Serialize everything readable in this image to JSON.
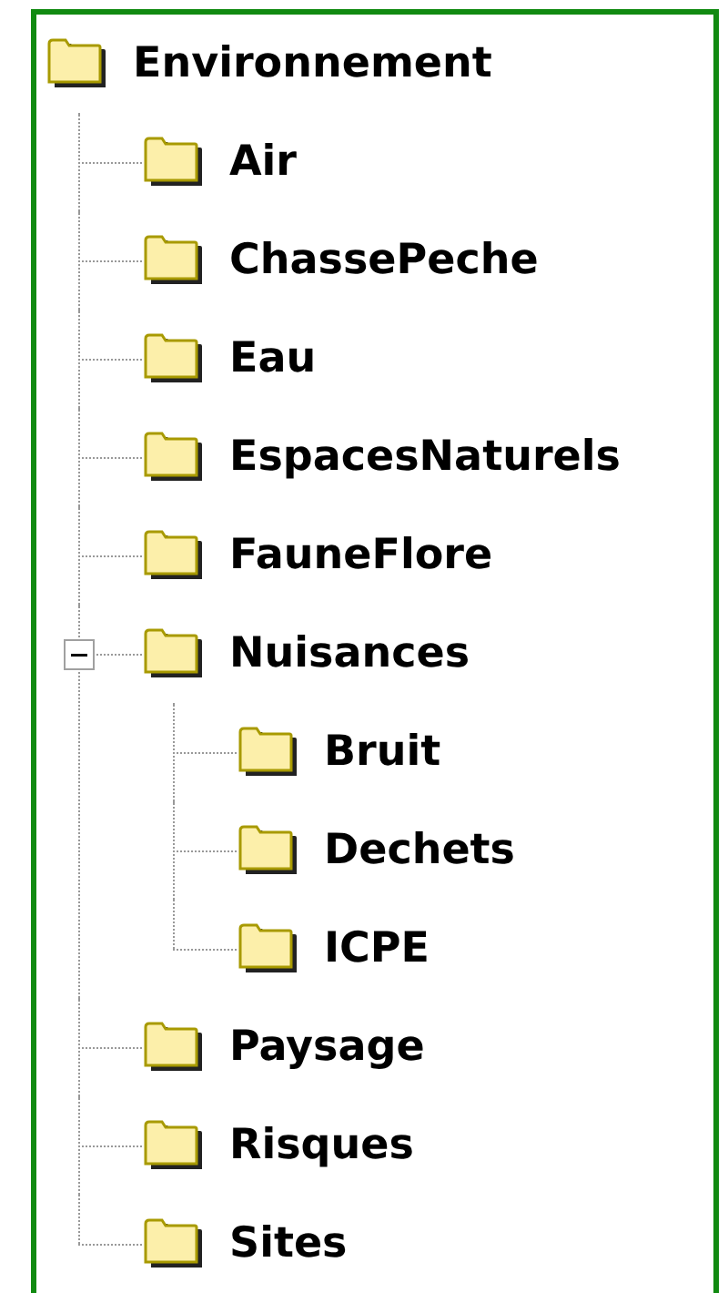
{
  "tree": {
    "label": "Environnement",
    "children": [
      {
        "label": "Air"
      },
      {
        "label": "ChassePeche"
      },
      {
        "label": "Eau"
      },
      {
        "label": "EspacesNaturels"
      },
      {
        "label": "FauneFlore"
      },
      {
        "label": "Nuisances",
        "expanded": true,
        "children": [
          {
            "label": "Bruit"
          },
          {
            "label": "Dechets"
          },
          {
            "label": "ICPE"
          }
        ]
      },
      {
        "label": "Paysage"
      },
      {
        "label": "Risques"
      },
      {
        "label": "Sites"
      }
    ]
  }
}
